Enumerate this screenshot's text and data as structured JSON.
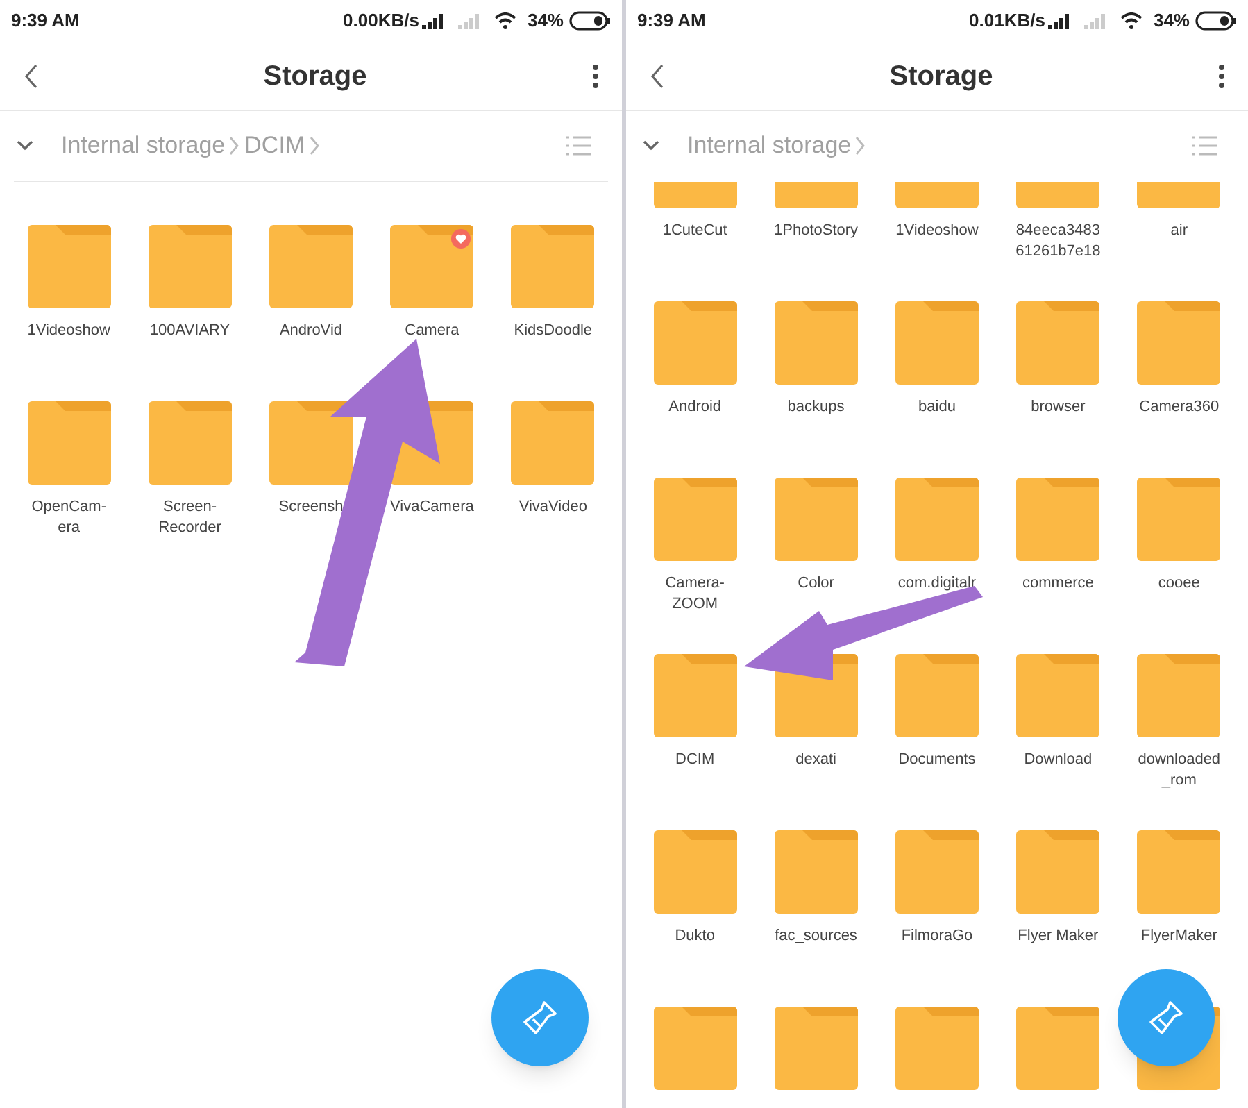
{
  "screens": [
    {
      "status_bar": {
        "time": "9:39 AM",
        "speed": "0.00KB/s",
        "battery": "34%"
      },
      "title": "Storage",
      "breadcrumb": [
        "Internal storage",
        "DCIM"
      ],
      "scrolled": false,
      "folders": [
        {
          "label": "1Videoshow",
          "favorite": false
        },
        {
          "label": "100AVIARY",
          "favorite": false
        },
        {
          "label": "AndroVid",
          "favorite": false
        },
        {
          "label": "Camera",
          "favorite": true
        },
        {
          "label": "KidsDoodle",
          "favorite": false
        },
        {
          "label": "OpenCam-\nera",
          "favorite": false
        },
        {
          "label": "Screen-\nRecorder",
          "favorite": false
        },
        {
          "label": "Screensh",
          "favorite": false
        },
        {
          "label": "VivaCamera",
          "favorite": false
        },
        {
          "label": "VivaVideo",
          "favorite": false
        }
      ]
    },
    {
      "status_bar": {
        "time": "9:39 AM",
        "speed": "0.01KB/s",
        "battery": "34%"
      },
      "title": "Storage",
      "breadcrumb": [
        "Internal storage"
      ],
      "scrolled": true,
      "folders": [
        {
          "kind": "folder",
          "label": "1CuteCut"
        },
        {
          "kind": "folder",
          "label": "1PhotoStory"
        },
        {
          "kind": "folder",
          "label": "1Videoshow"
        },
        {
          "kind": "folder",
          "label": "84eeca3483\n61261b7e18"
        },
        {
          "kind": "folder",
          "label": "air"
        },
        {
          "kind": "folder",
          "label": "Android"
        },
        {
          "kind": "folder",
          "label": "backups"
        },
        {
          "kind": "folder",
          "label": "baidu"
        },
        {
          "kind": "folder",
          "label": "browser"
        },
        {
          "kind": "folder",
          "label": "Camera360"
        },
        {
          "kind": "folder",
          "label": "Camera-\nZOOM"
        },
        {
          "kind": "folder",
          "label": "Color"
        },
        {
          "kind": "folder",
          "label": "com.digitalr"
        },
        {
          "kind": "folder",
          "label": "commerce"
        },
        {
          "kind": "folder",
          "label": "cooee"
        },
        {
          "kind": "folder",
          "label": "DCIM"
        },
        {
          "kind": "folder",
          "label": "dexati"
        },
        {
          "kind": "folder",
          "label": "Documents"
        },
        {
          "kind": "folder",
          "label": "Download"
        },
        {
          "kind": "folder",
          "label": "downloaded\n_rom"
        },
        {
          "kind": "folder",
          "label": "Dukto"
        },
        {
          "kind": "folder",
          "label": "fac_sources"
        },
        {
          "kind": "folder",
          "label": "FilmoraGo"
        },
        {
          "kind": "folder",
          "label": "Flyer Maker"
        },
        {
          "kind": "folder",
          "label": "FlyerMaker"
        },
        {
          "kind": "folder_only"
        },
        {
          "kind": "folder_only"
        },
        {
          "kind": "folder_only"
        },
        {
          "kind": "folder_only"
        },
        {
          "kind": "folder_only"
        }
      ]
    }
  ]
}
